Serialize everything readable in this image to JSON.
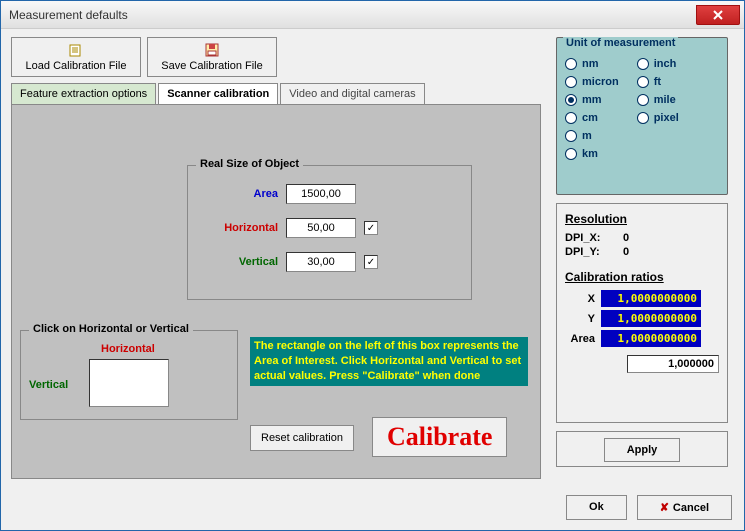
{
  "window": {
    "title": "Measurement defaults"
  },
  "toolbar": {
    "load_label": "Load Calibration File",
    "save_label": "Save Calibration File"
  },
  "tabs": {
    "t0": "Feature extraction options",
    "t1": "Scanner calibration",
    "t2": "Video and digital cameras",
    "active": "t1"
  },
  "real_size": {
    "legend": "Real Size of Object",
    "area_label": "Area",
    "area_value": "1500,00",
    "horiz_label": "Horizontal",
    "horiz_value": "50,00",
    "horiz_checked": "✓",
    "vert_label": "Vertical",
    "vert_value": "30,00",
    "vert_checked": "✓"
  },
  "aoi": {
    "legend": "Click on  Horizontal or Vertical",
    "h_label": "Horizontal",
    "v_label": "Vertical"
  },
  "hint_text": "The rectangle on the left of this box represents the Area of Interest. Click Horizontal and Vertical  to set actual values. Press \"Calibrate\" when done",
  "buttons": {
    "reset": "Reset calibration",
    "calibrate": "Calibrate",
    "apply": "Apply",
    "ok": "Ok",
    "cancel": "Cancel"
  },
  "units": {
    "legend": "Unit of measurement",
    "left": [
      "nm",
      "micron",
      "mm",
      "cm",
      "m",
      "km"
    ],
    "right": [
      "inch",
      "ft",
      "mile",
      "pixel"
    ],
    "selected": "mm"
  },
  "resolution": {
    "heading": "Resolution",
    "dpix_label": "DPI_X:",
    "dpix_value": "0",
    "dpiy_label": "DPI_Y:",
    "dpiy_value": "0"
  },
  "ratios": {
    "heading": "Calibration ratios",
    "x_label": "X",
    "x_value": "1,0000000000",
    "y_label": "Y",
    "y_value": "1,0000000000",
    "area_label": "Area",
    "area_value": "1,0000000000",
    "input_value": "1,000000"
  }
}
